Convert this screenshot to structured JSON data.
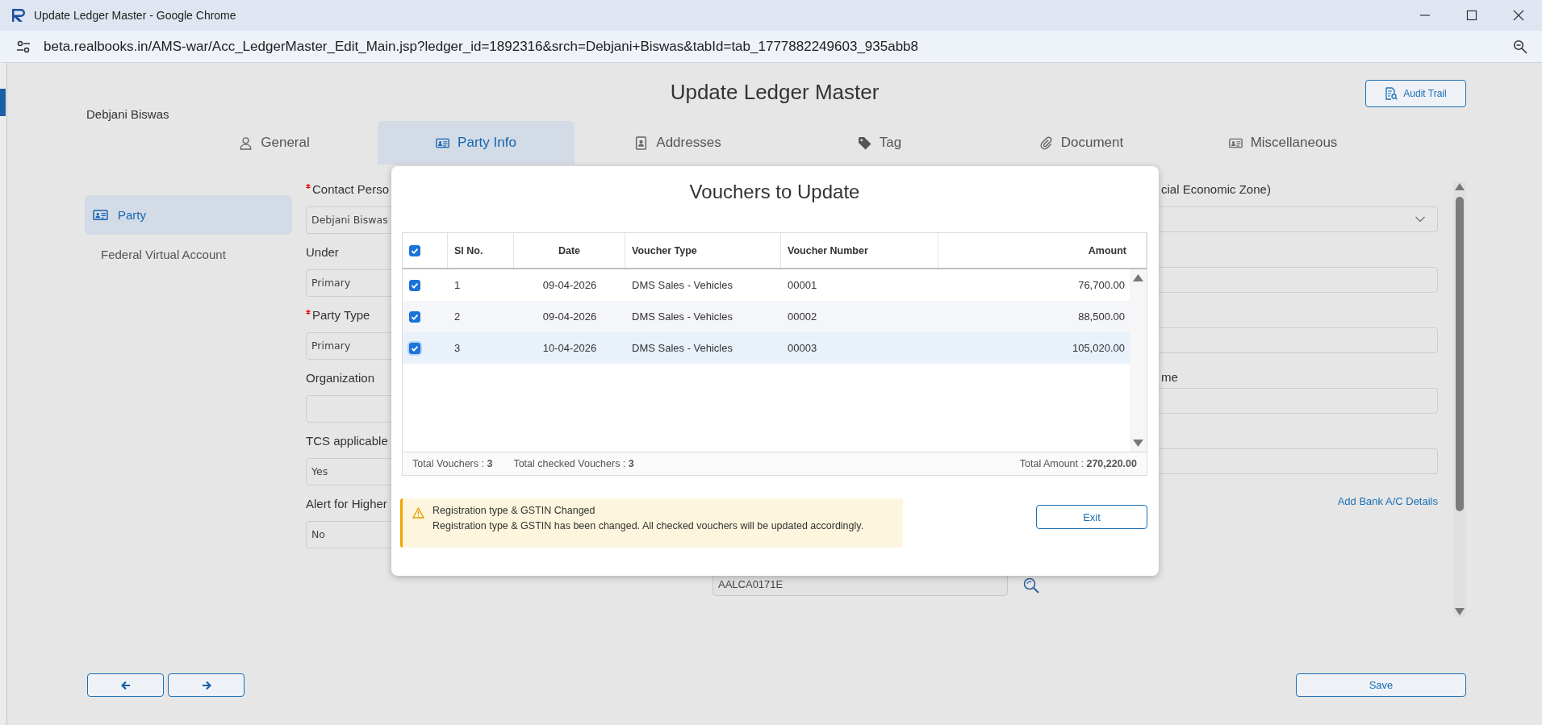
{
  "browser": {
    "title": "Update Ledger Master - Google Chrome",
    "url": "beta.realbooks.in/AMS-war/Acc_LedgerMaster_Edit_Main.jsp?ledger_id=1892316&srch=Debjani+Biswas&tabId=tab_1777882249603_935abb8"
  },
  "header": {
    "title": "Update Ledger Master",
    "party_name": "Debjani Biswas",
    "audit_button": "Audit Trail"
  },
  "tabs": [
    {
      "label": "General",
      "selected": false
    },
    {
      "label": "Party Info",
      "selected": true
    },
    {
      "label": "Addresses",
      "selected": false
    },
    {
      "label": "Tag",
      "selected": false
    },
    {
      "label": "Document",
      "selected": false
    },
    {
      "label": "Miscellaneous",
      "selected": false
    }
  ],
  "sidebar": {
    "items": [
      {
        "label": "Party",
        "selected": true
      },
      {
        "label": "Federal Virtual Account",
        "selected": false
      }
    ]
  },
  "form_left": [
    {
      "label": "Contact Perso",
      "required": true,
      "value": "Debjani Biswas"
    },
    {
      "label": "Under",
      "required": false,
      "value": "Primary"
    },
    {
      "label": "Party Type",
      "required": true,
      "value": "Primary"
    },
    {
      "label": "Organization",
      "required": false
    },
    {
      "label": "TCS applicable",
      "required": false,
      "value": "Yes"
    },
    {
      "label": "Alert for Higher",
      "required": false,
      "value": "No"
    }
  ],
  "pan_field": {
    "value": "AALCA0171E"
  },
  "form_right": {
    "fields": [
      {
        "kind": "select",
        "label": "cial Economic Zone)"
      },
      {
        "kind": "text"
      },
      {
        "kind": "text"
      },
      {
        "kind": "text",
        "label": "me"
      },
      {
        "kind": "text"
      }
    ],
    "link": "Add Bank A/C Details"
  },
  "dialog": {
    "title": "Vouchers to Update",
    "select_all": {
      "checked": true
    },
    "columns": [
      "Sl No.",
      "Date",
      "Voucher Type",
      "Voucher Number",
      "Amount"
    ],
    "rows": [
      {
        "checked": true,
        "selected": false,
        "cells": [
          "1",
          "09-04-2026",
          "DMS Sales - Vehicles",
          "00001",
          "76,700.00"
        ]
      },
      {
        "checked": true,
        "selected": false,
        "cells": [
          "2",
          "09-04-2026",
          "DMS Sales - Vehicles",
          "00002",
          "88,500.00"
        ]
      },
      {
        "checked": true,
        "selected": true,
        "cells": [
          "3",
          "10-04-2026",
          "DMS Sales - Vehicles",
          "00003",
          "105,020.00"
        ]
      }
    ],
    "summary": {
      "total_vouchers": "Total Vouchers : **3**",
      "total_checked": "Total checked Vouchers : **3**",
      "total_amount": "Total Amount : **270,220.00**"
    },
    "alert": {
      "title": "Registration type & GSTIN Changed",
      "message": "Registration type & GSTIN has been changed. All checked vouchers will be updated accordingly."
    },
    "exit_button": "Exit"
  },
  "footer": {
    "save_button": "Save"
  }
}
